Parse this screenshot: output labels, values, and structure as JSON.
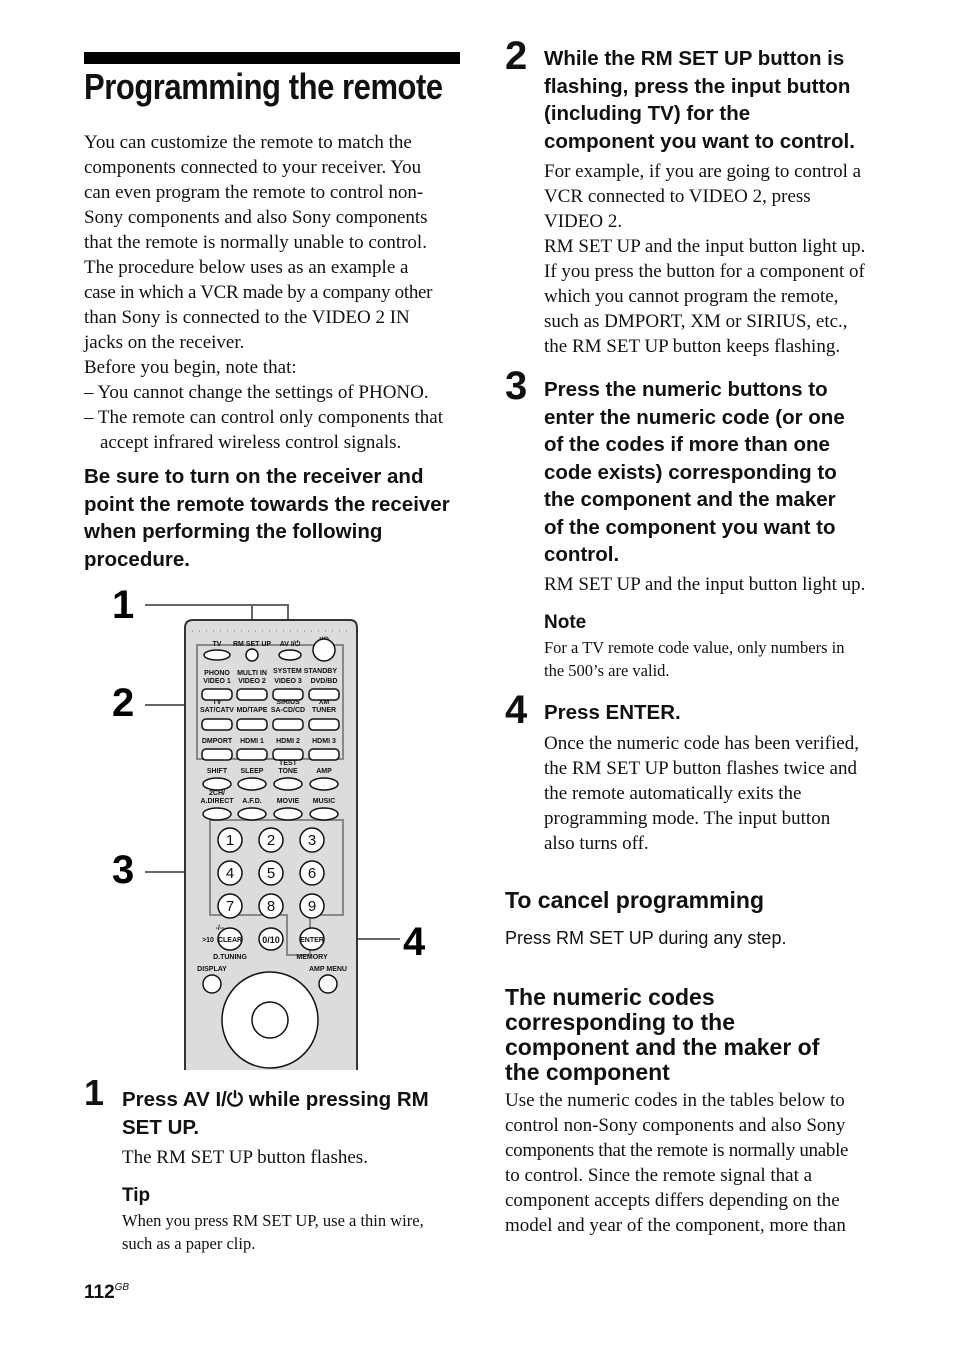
{
  "page": {
    "title": "Programming the remote",
    "page_number": "112",
    "page_suffix": "GB"
  },
  "intro": {
    "lines": [
      "You can customize the remote to match the",
      "components connected to your receiver. You",
      "can even program the remote to control non-",
      "Sony components and also Sony components",
      "that the remote is normally unable to control.",
      "The procedure below uses as an example a",
      "case in which a VCR made by a company other",
      "than Sony is connected to the VIDEO 2 IN",
      "jacks on the receiver.",
      "Before you begin, note that:"
    ],
    "bullets": [
      "– You cannot change the settings of PHONO.",
      "– The remote can control only components that accept infrared wireless control signals."
    ]
  },
  "warning": "Be sure to turn on the receiver and point the remote towards the receiver when performing the following procedure.",
  "figure": {
    "callouts": [
      "1",
      "2",
      "3",
      "4"
    ],
    "remote": {
      "top_labels": [
        "TV",
        "RM SET UP",
        "AV I/⏻",
        "I/⏻"
      ],
      "row1_top": [
        "PHONO",
        "MULTI IN",
        "SYSTEM STANDBY",
        ""
      ],
      "row1": [
        "VIDEO 1",
        "VIDEO 2",
        "VIDEO 3",
        "DVD/BD"
      ],
      "row2_top": [
        "TV",
        "",
        "SIRIUS",
        "XM"
      ],
      "row2": [
        "SAT/CATV",
        "MD/TAPE",
        "SA-CD/CD",
        "TUNER"
      ],
      "row3": [
        "DMPORT",
        "HDMI 1",
        "HDMI 2",
        "HDMI 3"
      ],
      "row4_top": [
        "",
        "",
        "TEST",
        ""
      ],
      "row4": [
        "SHIFT",
        "SLEEP",
        "TONE",
        "AMP"
      ],
      "row5_top": [
        "2CH/",
        "",
        "",
        ""
      ],
      "row5": [
        "A.DIRECT",
        "A.F.D.",
        "MOVIE",
        "MUSIC"
      ],
      "digits": [
        "1",
        "2",
        "3",
        "4",
        "5",
        "6",
        "7",
        "8",
        "9"
      ],
      "clear": "CLEAR",
      "zero": "0/10",
      "enter": "ENTER",
      "gt10": ">10",
      "dash_label": "-/--",
      "d_tuning": "D.TUNING",
      "memory": "MEMORY",
      "display": "DISPLAY",
      "amp_menu": "AMP MENU"
    }
  },
  "steps": [
    {
      "number": "1",
      "heading_lines": [
        "Press AV I/⏻ while pressing RM",
        "SET UP."
      ],
      "body": [
        "The RM SET UP button flashes."
      ],
      "tip_label": "Tip",
      "tip": [
        "When you press RM SET UP, use a thin wire,",
        "such as a paper clip."
      ]
    },
    {
      "number": "2",
      "heading_lines": [
        "While the RM SET UP button is",
        "flashing, press the input button",
        "(including TV) for the",
        "component you want to control."
      ],
      "body": [
        "For example, if you are going to control a",
        "VCR connected to VIDEO 2, press",
        "VIDEO 2.",
        "RM SET UP and the input button light up.",
        "If you press the button for a component of",
        "which you cannot program the remote,",
        "such as DMPORT, XM or SIRIUS, etc.,",
        "the RM SET UP button keeps flashing."
      ]
    },
    {
      "number": "3",
      "heading_lines": [
        "Press the numeric buttons to",
        "enter the numeric code (or one",
        "of the codes if more than one",
        "code exists) corresponding to",
        "the component and the maker",
        "of the component you want to",
        "control."
      ],
      "body": [
        "RM SET UP and the input button light up."
      ],
      "note_label": "Note",
      "note": [
        "For a TV remote code value, only numbers in",
        "the 500’s are valid."
      ]
    },
    {
      "number": "4",
      "heading_lines": [
        "Press ENTER."
      ],
      "body": [
        "Once the numeric code has been verified,",
        "the RM SET UP button flashes twice and",
        "the remote automatically exits the",
        "programming mode. The input button",
        "also turns off."
      ]
    }
  ],
  "cancel": {
    "heading": "To cancel programming",
    "body": "Press RM SET UP during any step."
  },
  "codes_section": {
    "heading_lines": [
      "The numeric codes",
      "corresponding to the",
      "component and the maker of",
      "the component"
    ],
    "body": [
      "Use the numeric codes in the tables below to",
      "control non-Sony components and also Sony",
      "components that the remote is normally unable",
      "to control. Since the remote signal that a",
      "component accepts differs depending on the",
      "model and year of the component, more than"
    ]
  }
}
